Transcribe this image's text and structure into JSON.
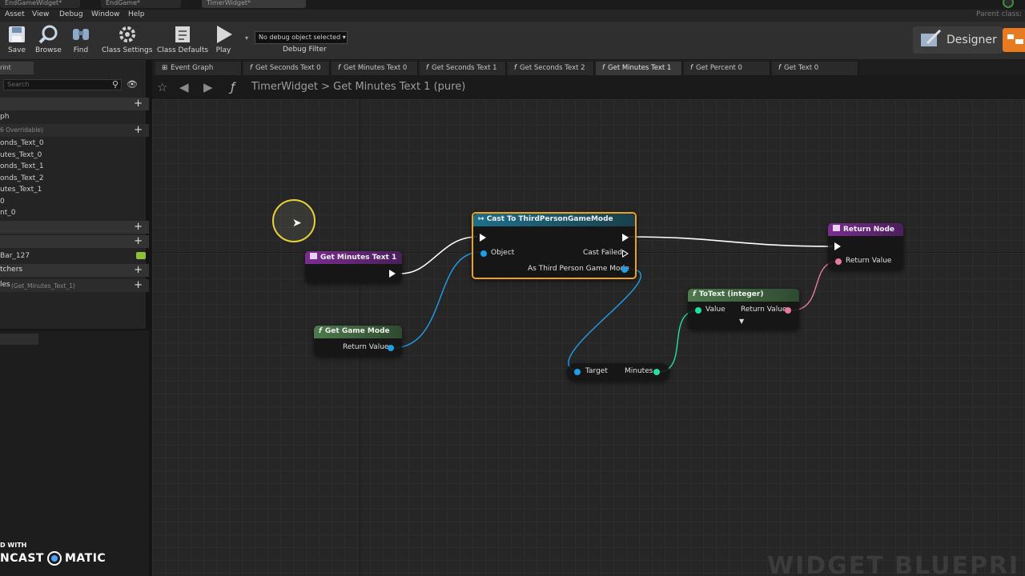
{
  "doc_tabs": [
    "EndGameWidget*",
    "EndGame*",
    "TimerWidget*"
  ],
  "parent_class_label": "Parent class:",
  "menu": [
    "Asset",
    "View",
    "Debug",
    "Window",
    "Help"
  ],
  "toolbar": {
    "save": "Save",
    "browse": "Browse",
    "find": "Find",
    "class_settings": "Class Settings",
    "class_defaults": "Class Defaults",
    "play": "Play",
    "debug_object": "No debug object selected",
    "debug_filter": "Debug Filter",
    "designer": "Designer"
  },
  "left_panel": {
    "tab": "rint",
    "search_placeholder": "Search",
    "graph_section": "ph",
    "functions_sub": "6 Overridable)",
    "function_items": [
      "onds_Text_0",
      "utes_Text_0",
      "onds_Text_1",
      "onds_Text_2",
      "utes_Text_1",
      "0",
      "nt_0"
    ],
    "var_item": "Bar_127",
    "dispatchers": "tchers",
    "locals": "les",
    "locals_sub": "(Get_Minutes_Text_1)",
    "watermark_top": "D WITH",
    "watermark_a": "NCAST",
    "watermark_b": "MATIC"
  },
  "graph_tabs": [
    {
      "label": "Event Graph",
      "icon": "event-graph-icon",
      "active": false
    },
    {
      "label": "Get Seconds Text 0",
      "icon": "function-icon",
      "active": false
    },
    {
      "label": "Get Minutes Text 0",
      "icon": "function-icon",
      "active": false
    },
    {
      "label": "Get Seconds Text 1",
      "icon": "function-icon",
      "active": false
    },
    {
      "label": "Get Seconds Text 2",
      "icon": "function-icon",
      "active": false
    },
    {
      "label": "Get Minutes Text 1",
      "icon": "function-icon",
      "active": true
    },
    {
      "label": "Get Percent 0",
      "icon": "function-icon",
      "active": false
    },
    {
      "label": "Get Text 0",
      "icon": "function-icon",
      "active": false
    }
  ],
  "breadcrumb": {
    "root": "TimerWidget",
    "separator": ">",
    "current": "Get Minutes Text 1 (pure)"
  },
  "nodes": {
    "entry": {
      "title": "Get Minutes Text 1"
    },
    "cast": {
      "title": "Cast To ThirdPersonGameMode",
      "object": "Object",
      "cast_failed": "Cast Failed",
      "as_mode": "As Third Person Game Mode"
    },
    "game_mode": {
      "title": "Get Game Mode",
      "return_value": "Return Value"
    },
    "to_text": {
      "title": "ToText (integer)",
      "value": "Value",
      "return_value": "Return Value"
    },
    "minutes": {
      "target": "Target",
      "minutes": "Minutes"
    },
    "return": {
      "title": "Return Node",
      "return_value": "Return Value"
    }
  },
  "canvas_watermark": "WIDGET BLUEPRI",
  "colors": {
    "entry_header": "#7a2d8f",
    "cast_header": "#1e6f8a",
    "pure_header": "#4e7a4e",
    "object_pin": "#1ea0e8",
    "int_pin": "#24e0a0",
    "text_pin": "#e87aa0",
    "selected_border": "#f0a020"
  }
}
